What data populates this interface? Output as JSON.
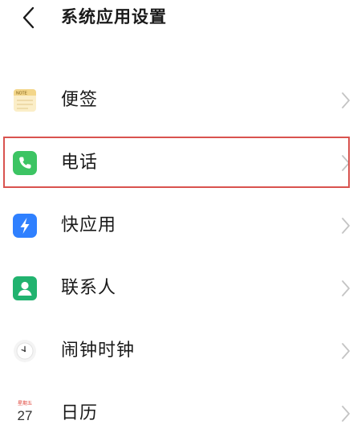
{
  "header": {
    "title": "系统应用设置",
    "back_icon": "chevron-left-icon"
  },
  "items": [
    {
      "key": "notes",
      "label": "便签",
      "icon": "notes-icon",
      "icon_text": "NOTE",
      "color": "#f3d68a"
    },
    {
      "key": "phone",
      "label": "电话",
      "icon": "phone-icon",
      "color": "#3cc463"
    },
    {
      "key": "quickapp",
      "label": "快应用",
      "icon": "lightning-icon",
      "color": "#2f80ff"
    },
    {
      "key": "contacts",
      "label": "联系人",
      "icon": "contact-person-icon",
      "color": "#21b36f"
    },
    {
      "key": "clock",
      "label": "闹钟时钟",
      "icon": "clock-icon",
      "color": "#f2f2f2"
    },
    {
      "key": "calendar",
      "label": "日历",
      "icon": "calendar-icon",
      "calendar_weekday": "星期五",
      "calendar_day": "27",
      "color": "#e0443a"
    }
  ],
  "highlight": {
    "target": "phone",
    "color": "#d9534f"
  }
}
